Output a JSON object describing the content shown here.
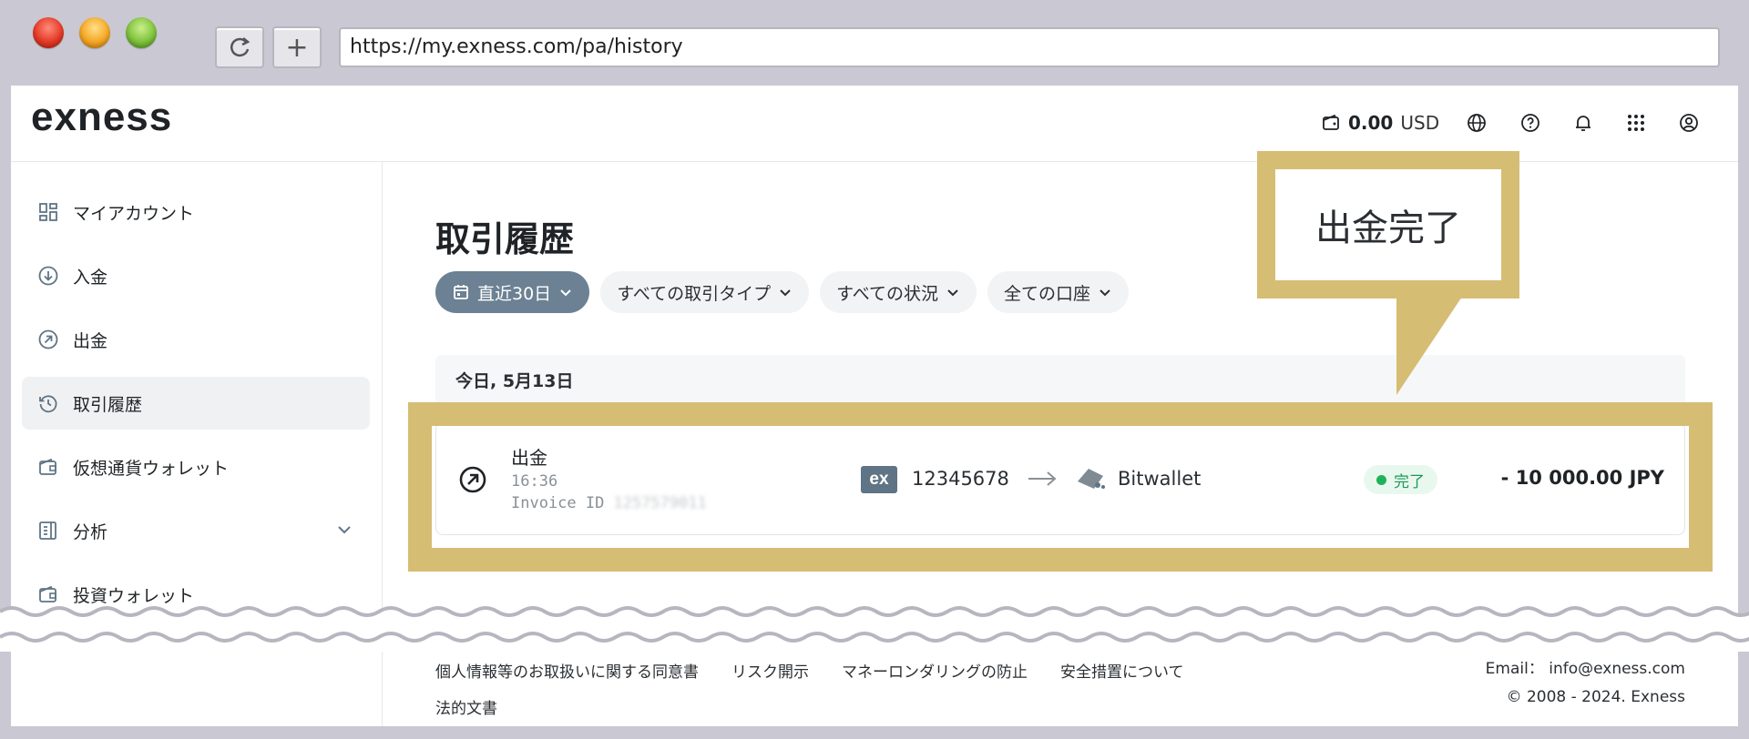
{
  "browser": {
    "url": "https://my.exness.com/pa/history",
    "reload_icon": "reload-icon",
    "newtab_label": "+"
  },
  "header": {
    "logo": "exness",
    "balance_amount": "0.00",
    "balance_currency": "USD",
    "icons": [
      "wallet-icon",
      "globe-icon",
      "help-icon",
      "bell-icon",
      "apps-grid-icon",
      "user-icon"
    ]
  },
  "sidebar": {
    "items": [
      {
        "label": "マイアカウント",
        "icon": "dashboard-icon"
      },
      {
        "label": "入金",
        "icon": "deposit-icon"
      },
      {
        "label": "出金",
        "icon": "withdraw-icon"
      },
      {
        "label": "取引履歴",
        "icon": "history-icon",
        "active": true
      },
      {
        "label": "仮想通貨ウォレット",
        "icon": "crypto-wallet-icon"
      },
      {
        "label": "分析",
        "icon": "analytics-icon",
        "expandable": true
      },
      {
        "label": "投資ウォレット",
        "icon": "invest-wallet-icon"
      }
    ]
  },
  "main": {
    "title": "取引履歴",
    "filters": [
      {
        "label": "直近30日",
        "active": true
      },
      {
        "label": "すべての取引タイプ"
      },
      {
        "label": "すべての状況"
      },
      {
        "label": "全ての口座"
      }
    ],
    "date_header": "今日, 5月13日",
    "transaction": {
      "type": "出金",
      "time": "16:36",
      "invoice_label": "Invoice ID",
      "invoice_id": "1257579011",
      "account_badge": "ex",
      "account_number": "12345678",
      "destination": "Bitwallet",
      "status": "完了",
      "amount": "- 10 000.00 JPY"
    }
  },
  "annotation": {
    "callout_text": "出金完了",
    "color": "#d6bd74"
  },
  "footer": {
    "links": [
      "個人情報等のお取扱いに関する同意書",
      "リスク開示",
      "マネーロンダリングの防止",
      "安全措置について"
    ],
    "legal": "法的文書",
    "email": "Email： info@exness.com",
    "copyright": "© 2008 - 2024. Exness"
  },
  "colors": {
    "frame": "#c9c8d3",
    "active_pill": "#6c8193",
    "status_green": "#1fb25a",
    "highlight": "#d6bd74"
  }
}
